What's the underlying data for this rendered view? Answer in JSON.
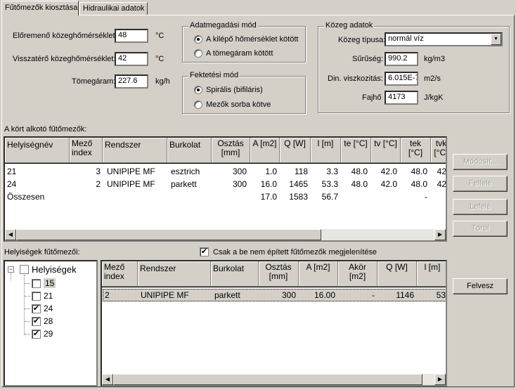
{
  "tabs": [
    "Fűtőmezők kiosztása",
    "Hidraulikai adatok"
  ],
  "temps": {
    "supply_label": "Előremenő közeghőmérséklet:",
    "supply_value": "48",
    "supply_unit": "°C",
    "return_label": "Visszatérő közeghőmérséklet:",
    "return_value": "42",
    "return_unit": "°C",
    "mass_label": "Tömegáram:",
    "mass_value": "227.6",
    "mass_unit": "kg/h"
  },
  "input_mode": {
    "title": "Adatmegadási mód",
    "opt1": "A kilépő hőmérséklet kötött",
    "opt2": "A tömegáram kötött"
  },
  "laying_mode": {
    "title": "Fektetési mód",
    "opt1": "Spirális (bifiláris)",
    "opt2": "Mezők sorba kötve"
  },
  "medium": {
    "title": "Közeg adatok",
    "type_label": "Közeg típusa:",
    "type_value": "normál víz",
    "density_label": "Sűrűség:",
    "density_value": "990.2",
    "density_unit": "kg/m3",
    "visc_label": "Din. viszkozitás:",
    "visc_value": "6.015E-7",
    "visc_unit": "m2/s",
    "heat_label": "Fajhő",
    "heat_value": "4173",
    "heat_unit": "J/kgK"
  },
  "circuit": {
    "label": "A kört alkotó fűtőmezők:",
    "headers": [
      "Helyiségnév",
      "Mező index",
      "Rendszer",
      "Burkolat",
      "Osztás [mm]",
      "A [m2]",
      "Q [W]",
      "l [m]",
      "te [°C]",
      "tv [°C]",
      "tek [°C]",
      "tvk [°C]"
    ],
    "rows": [
      [
        "21",
        "3",
        "UNIPIPE MF",
        "esztrich",
        "300",
        "1.0",
        "118",
        "3.3",
        "48.0",
        "42.0",
        "48.0",
        "42"
      ],
      [
        "24",
        "2",
        "UNIPIPE MF",
        "parkett",
        "300",
        "16.0",
        "1465",
        "53.3",
        "48.0",
        "42.0",
        "48.0",
        "42"
      ],
      [
        "Összesen",
        "",
        "",
        "",
        "",
        "17.0",
        "1583",
        "56.7",
        "",
        "",
        "-",
        ""
      ]
    ]
  },
  "buttons": {
    "modify": "Módosít...",
    "up": "Felfelé",
    "down": "Lefelé",
    "delete": "Töröl",
    "add": "Felvesz"
  },
  "rooms": {
    "label": "Helyiségek fűtőmezői:",
    "filter_label": "Csak a be nem épített fűtőmezők megjelenítése",
    "tree_root": "Helyiségek",
    "tree_items": [
      "15",
      "21",
      "24",
      "28",
      "29"
    ],
    "headers": [
      "Mező index",
      "Rendszer",
      "Burkolat",
      "Osztás [mm]",
      "A [m2]",
      "Akör [m2]",
      "Q [W]",
      "l [m]"
    ],
    "rows": [
      [
        "2",
        "UNIPIPE MF",
        "parkett",
        "300",
        "16.00",
        "-",
        "1146",
        "53"
      ]
    ]
  }
}
